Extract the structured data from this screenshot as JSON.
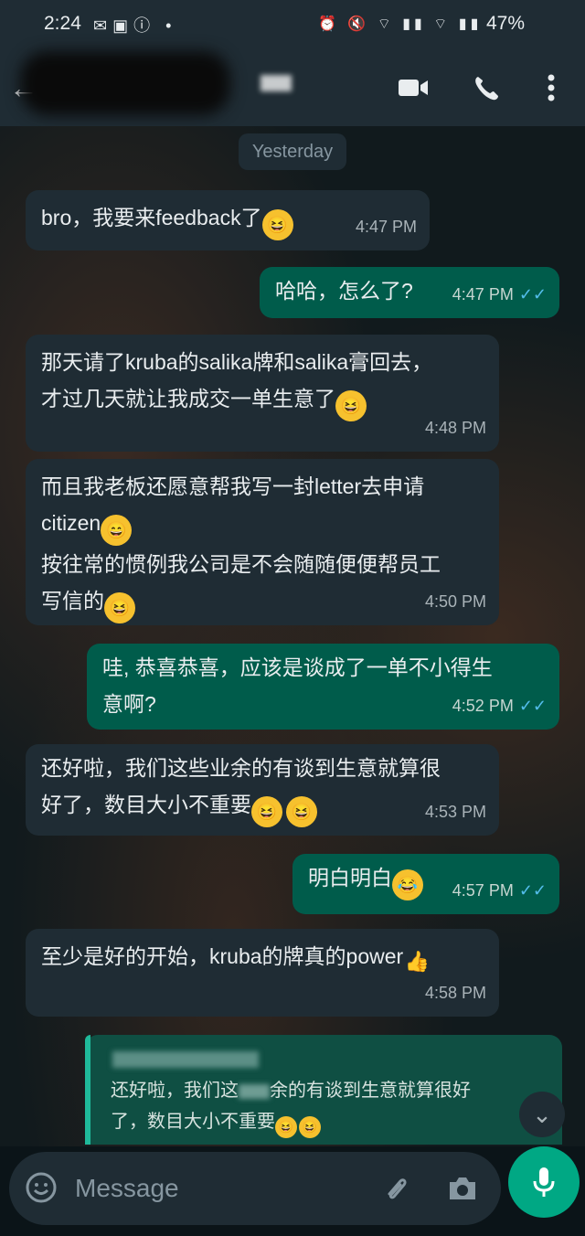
{
  "status_bar": {
    "time": "2:24",
    "battery": "47%"
  },
  "chat": {
    "date_chip": "Yesterday"
  },
  "messages": [
    {
      "lines": [
        "bro，我要来feedback了"
      ],
      "time": "4:47 PM"
    },
    {
      "lines": [
        "哈哈，怎么了?"
      ],
      "time": "4:47 PM"
    },
    {
      "lines": [
        "那天请了kruba的salika牌和salika膏回去，",
        "才过几天就让我成交一单生意了"
      ],
      "time": "4:48 PM"
    },
    {
      "lines": [
        "而且我老板还愿意帮我写一封letter去申请",
        "citizen",
        "按往常的惯例我公司是不会随随便便帮员工",
        "写信的"
      ],
      "time": "4:50 PM"
    },
    {
      "lines": [
        "哇, 恭喜恭喜，应该是谈成了一单不小得生",
        "意啊?"
      ],
      "time": "4:52 PM"
    },
    {
      "lines": [
        "还好啦，我们这些业余的有谈到生意就算很",
        "好了，数目大小不重要"
      ],
      "time": "4:53 PM"
    },
    {
      "lines": [
        "明白明白"
      ],
      "time": "4:57 PM"
    },
    {
      "lines": [
        "至少是好的开始，kruba的牌真的power"
      ],
      "time": "4:58 PM"
    }
  ],
  "reply_preview": {
    "lines": [
      "还好啦，我们这",
      "余的有谈到生意就算很好",
      "了，数目大小不重要"
    ]
  },
  "composer": {
    "placeholder": "Message"
  },
  "colors": {
    "header": "#1f2c34",
    "incoming": "#1f2c34",
    "outgoing": "#005c4b",
    "accent": "#00a884",
    "read_tick": "#53bdeb"
  }
}
